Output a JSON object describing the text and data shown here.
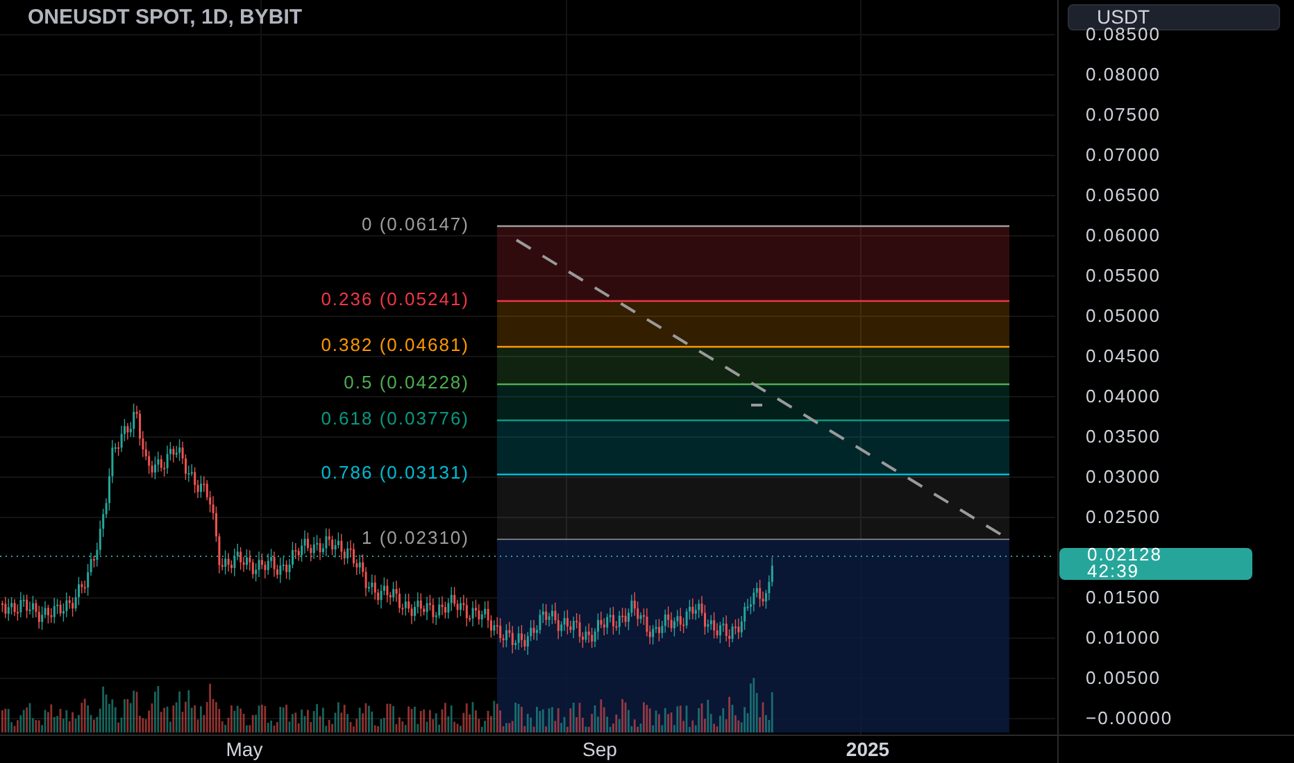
{
  "title": "ONEUSDT SPOT, 1D, BYBIT",
  "currency_button": "USDT",
  "fib_levels": [
    {
      "label": "0 (0.06147)",
      "color": "#9e9e9e"
    },
    {
      "label": "0.236 (0.05241)",
      "color": "#f23645"
    },
    {
      "label": "0.382 (0.04681)",
      "color": "#ff9800"
    },
    {
      "label": "0.5 (0.04228)",
      "color": "#4caf50"
    },
    {
      "label": "0.618 (0.03776)",
      "color": "#089981"
    },
    {
      "label": "0.786 (0.03131)",
      "color": "#00bcd4"
    },
    {
      "label": "1 (0.02310)",
      "color": "#9e9e9e"
    }
  ],
  "price_axis": [
    "0.08500",
    "0.08000",
    "0.07500",
    "0.07000",
    "0.06500",
    "0.06000",
    "0.05500",
    "0.05000",
    "0.04500",
    "0.04000",
    "0.03500",
    "0.03000",
    "0.02500",
    "0.01500",
    "0.01000",
    "0.00500",
    "−0.00000"
  ],
  "current_price": {
    "price": "0.02128",
    "countdown": "42:39"
  },
  "time_axis": [
    "May",
    "Sep",
    "2025"
  ]
}
